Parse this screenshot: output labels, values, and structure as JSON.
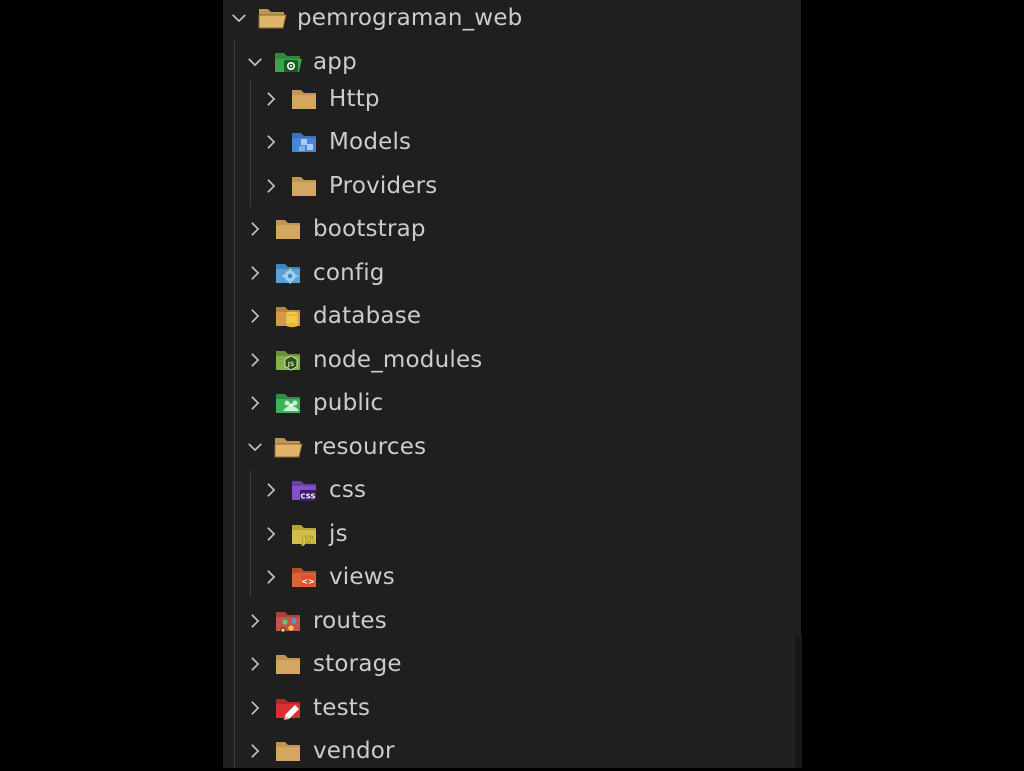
{
  "explorer": {
    "items": [
      {
        "label": "pemrograman_web",
        "icon": "folder-open-icon",
        "expanded": true
      },
      {
        "label": "app",
        "icon": "folder-app-icon",
        "expanded": true
      },
      {
        "label": "Http",
        "icon": "folder-icon",
        "expanded": false
      },
      {
        "label": "Models",
        "icon": "folder-models-icon",
        "expanded": false
      },
      {
        "label": "Providers",
        "icon": "folder-icon",
        "expanded": false
      },
      {
        "label": "bootstrap",
        "icon": "folder-icon",
        "expanded": false
      },
      {
        "label": "config",
        "icon": "folder-config-icon",
        "expanded": false
      },
      {
        "label": "database",
        "icon": "folder-database-icon",
        "expanded": false
      },
      {
        "label": "node_modules",
        "icon": "folder-node-icon",
        "expanded": false
      },
      {
        "label": "public",
        "icon": "folder-public-icon",
        "expanded": false
      },
      {
        "label": "resources",
        "icon": "folder-open-icon",
        "expanded": true
      },
      {
        "label": "css",
        "icon": "folder-css-icon",
        "expanded": false
      },
      {
        "label": "js",
        "icon": "folder-js-icon",
        "expanded": false
      },
      {
        "label": "views",
        "icon": "folder-views-icon",
        "expanded": false
      },
      {
        "label": "routes",
        "icon": "folder-routes-icon",
        "expanded": false
      },
      {
        "label": "storage",
        "icon": "folder-icon",
        "expanded": false
      },
      {
        "label": "tests",
        "icon": "folder-tests-icon",
        "expanded": false
      },
      {
        "label": "vendor",
        "icon": "folder-icon",
        "expanded": false
      }
    ]
  },
  "colors": {
    "panel_bg": "#1f1f1f",
    "text": "#cccccc",
    "chevron": "#c5c5c5",
    "folder": "#c09553"
  }
}
